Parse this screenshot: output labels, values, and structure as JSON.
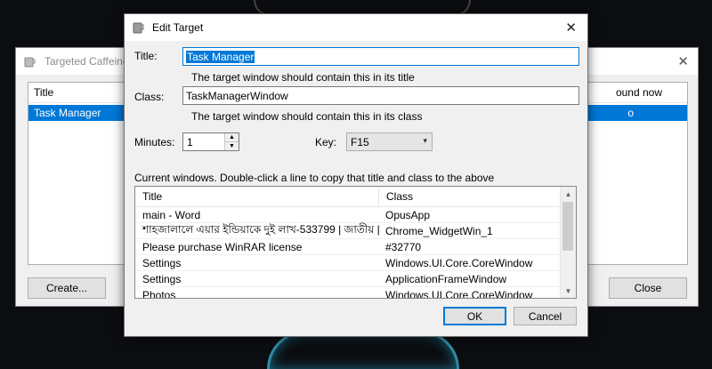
{
  "background_window": {
    "title": "Targeted Caffeine",
    "list_headers": {
      "title": "Title",
      "found_now": "ound now"
    },
    "list_row": {
      "title": "Task Manager",
      "found_now": "o"
    },
    "create_label": "Create...",
    "close_label": "Close"
  },
  "dialog": {
    "title": "Edit Target",
    "title_label": "Title:",
    "title_value": "Task Manager",
    "title_hint": "The target window should contain this in its title",
    "class_label": "Class:",
    "class_value": "TaskManagerWindow",
    "class_hint": "The target window should contain this in its class",
    "minutes_label": "Minutes:",
    "minutes_value": "1",
    "key_label": "Key:",
    "key_value": "F15",
    "windows_caption": "Current windows.  Double-click a line to copy that title and class to the above",
    "columns": {
      "title": "Title",
      "class": "Class"
    },
    "rows": [
      {
        "title": "main - Word",
        "class": "OpusApp"
      },
      {
        "title": "শাহজালালে এয়ার ইন্ডিয়াকে দুই লাখ-533799 | জাতীয় |...",
        "class": "Chrome_WidgetWin_1"
      },
      {
        "title": "Please purchase WinRAR license",
        "class": "#32770"
      },
      {
        "title": "Settings",
        "class": "Windows.UI.Core.CoreWindow"
      },
      {
        "title": "Settings",
        "class": "ApplicationFrameWindow"
      },
      {
        "title": "Photos",
        "class": "Windows.UI.Core.CoreWindow"
      }
    ],
    "ok_label": "OK",
    "cancel_label": "Cancel"
  },
  "colors": {
    "accent": "#0078d7",
    "window_bg": "#f0f0f0"
  }
}
